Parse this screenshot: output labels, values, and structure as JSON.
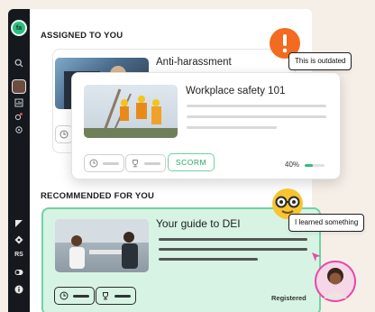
{
  "sidebar": {
    "logo_text": "fa",
    "icons": [
      "search-icon",
      "avatar",
      "chart-icon",
      "bell-icon",
      "circle-icon"
    ],
    "bottom_labels": [
      "RS"
    ]
  },
  "assigned": {
    "section_title": "ASSIGNED TO YOU",
    "back_card": {
      "title": "Anti-harassment"
    },
    "front_card": {
      "title": "Workplace safety 101",
      "tag": "SCORM",
      "progress_label": "40%",
      "progress": 0.4
    }
  },
  "recommended": {
    "section_title": "RECOMMENDED FOR YOU",
    "card": {
      "title": "Your guide to DEI",
      "status": "Registered"
    }
  },
  "annotations": {
    "outdated": "This is outdated",
    "learned": "I learned something"
  },
  "colors": {
    "accent": "#2dbd7e",
    "alert": "#f26b21",
    "rec_bg": "#d7f3e4"
  }
}
